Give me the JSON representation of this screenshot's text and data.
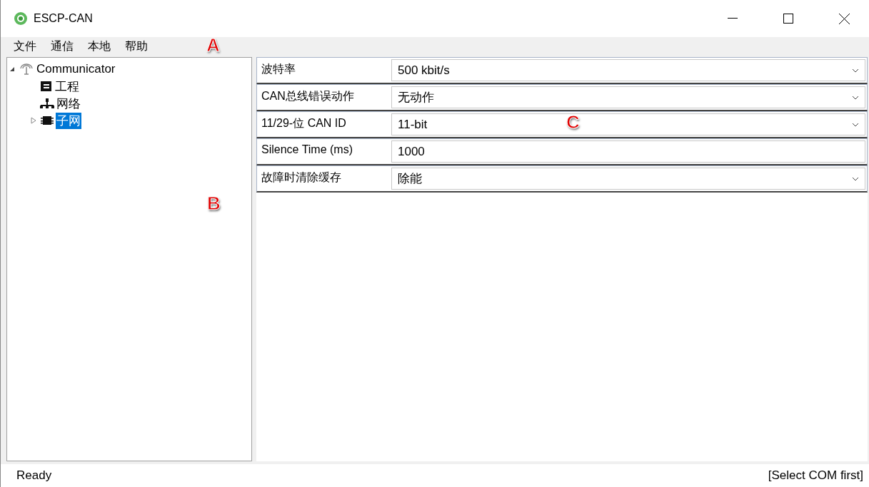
{
  "window": {
    "title": "ESCP-CAN"
  },
  "menu": [
    "文件",
    "通信",
    "本地",
    "帮助"
  ],
  "tree": [
    {
      "label": "Communicator",
      "kind": "antenna",
      "expanded": true,
      "selected": false,
      "children": [
        {
          "label": "工程",
          "kind": "project",
          "selected": false
        },
        {
          "label": "网络",
          "kind": "network",
          "selected": false
        },
        {
          "label": "子网",
          "kind": "chip",
          "expanded": false,
          "selected": true
        }
      ]
    }
  ],
  "properties": [
    {
      "label": "波特率",
      "kind": "dropdown",
      "value": "500 kbit/s"
    },
    {
      "label": "CAN总线错误动作",
      "kind": "dropdown",
      "value": "无动作"
    },
    {
      "label": "11/29-位 CAN ID",
      "kind": "dropdown",
      "value": "11-bit"
    },
    {
      "label": "Silence Time (ms)",
      "kind": "text",
      "value": "1000"
    },
    {
      "label": "故障时清除缓存",
      "kind": "dropdown",
      "value": "除能"
    }
  ],
  "callouts": [
    "A",
    "B",
    "C"
  ],
  "status_bar": {
    "left": "Ready",
    "right": "[Select COM first]"
  }
}
